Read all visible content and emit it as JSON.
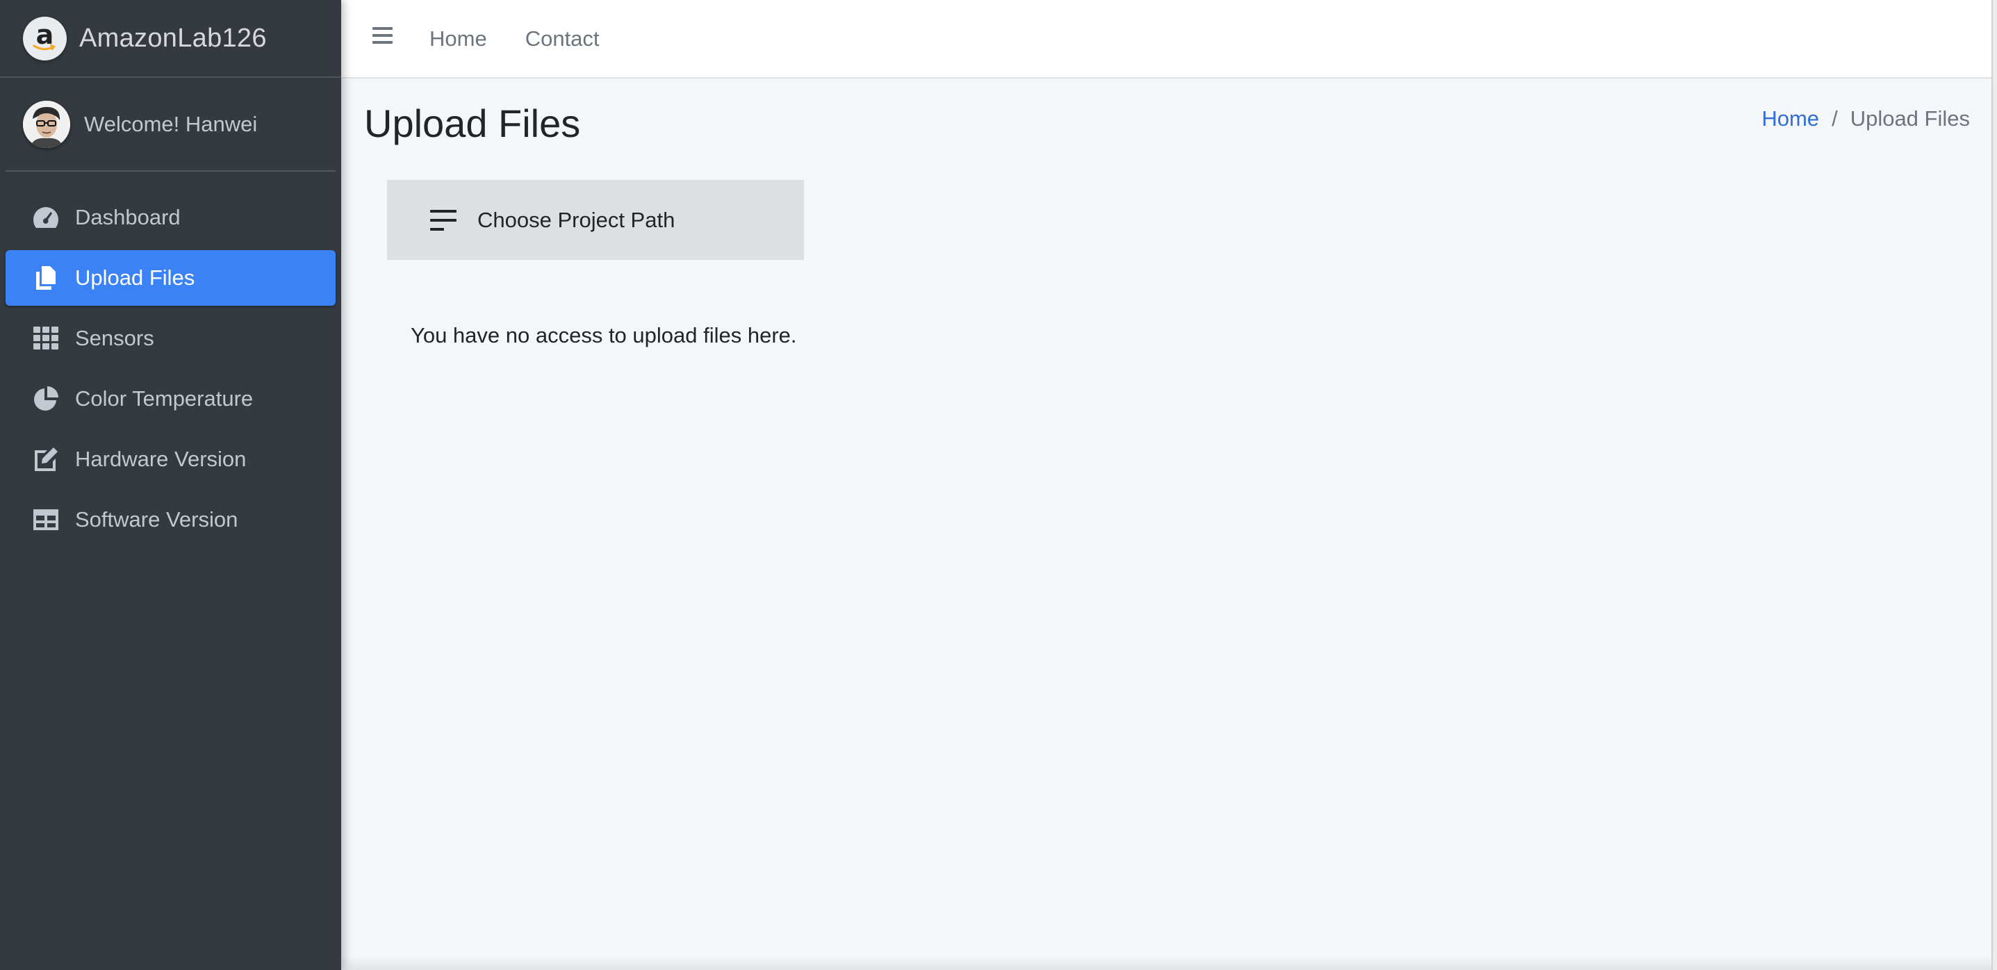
{
  "brand": {
    "name": "AmazonLab126",
    "logo_letter": "a"
  },
  "user": {
    "welcome": "Welcome! Hanwei"
  },
  "sidebar": {
    "items": [
      {
        "label": "Dashboard",
        "icon": "tachometer-icon",
        "active": false
      },
      {
        "label": "Upload Files",
        "icon": "copy-files-icon",
        "active": true
      },
      {
        "label": "Sensors",
        "icon": "grid-icon",
        "active": false
      },
      {
        "label": "Color Temperature",
        "icon": "pie-chart-icon",
        "active": false
      },
      {
        "label": "Hardware Version",
        "icon": "edit-icon",
        "active": false
      },
      {
        "label": "Software Version",
        "icon": "table-icon",
        "active": false
      }
    ]
  },
  "topbar": {
    "menu_icon": "bars-icon",
    "links": [
      "Home",
      "Contact"
    ]
  },
  "page": {
    "title": "Upload Files",
    "breadcrumb": {
      "home": "Home",
      "separator": "/",
      "current": "Upload Files"
    },
    "path_button_label": "Choose Project Path",
    "message": "You have no access to upload files here."
  },
  "colors": {
    "sidebar_bg": "#343a40",
    "active_item": "#3b82f6",
    "link_blue": "#2f6fd6",
    "content_bg": "#f4f6f9",
    "path_button_bg": "#dce0e3"
  }
}
